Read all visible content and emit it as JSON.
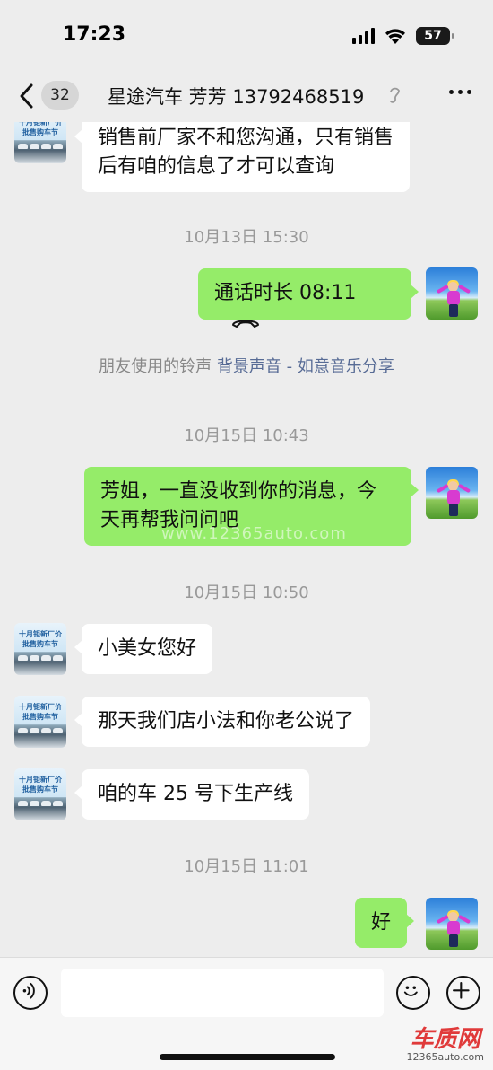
{
  "status_bar": {
    "time": "17:23",
    "battery": "57"
  },
  "nav": {
    "unread_count": "32",
    "title": "星途汽车  芳芳 13792468519"
  },
  "shop_avatar": {
    "line1": "十月钜新厂价",
    "line2": "批售购车节"
  },
  "messages": [
    {
      "text": "销售前厂家不和您沟通，只有销售后有咱的信息了才可以查询"
    },
    {
      "text": "通话时长 08:11"
    },
    {
      "text": "芳姐，一直没收到你的消息，今天再帮我问问吧"
    },
    {
      "text": "小美女您好"
    },
    {
      "text": "那天我们店小法和你老公说了"
    },
    {
      "text": "咱的车 25 号下生产线"
    },
    {
      "text": "好"
    }
  ],
  "timestamps": [
    "10月13日 15:30",
    "10月15日 10:43",
    "10月15日 10:50",
    "10月15日 11:01"
  ],
  "system_notice": {
    "prefix": "朋友使用的铃声",
    "link": "背景声音 - 如意音乐分享"
  },
  "watermark": "www.12365auto.com",
  "brand": {
    "name": "车质网",
    "url": "12365auto.com"
  },
  "input": {
    "placeholder": ""
  }
}
